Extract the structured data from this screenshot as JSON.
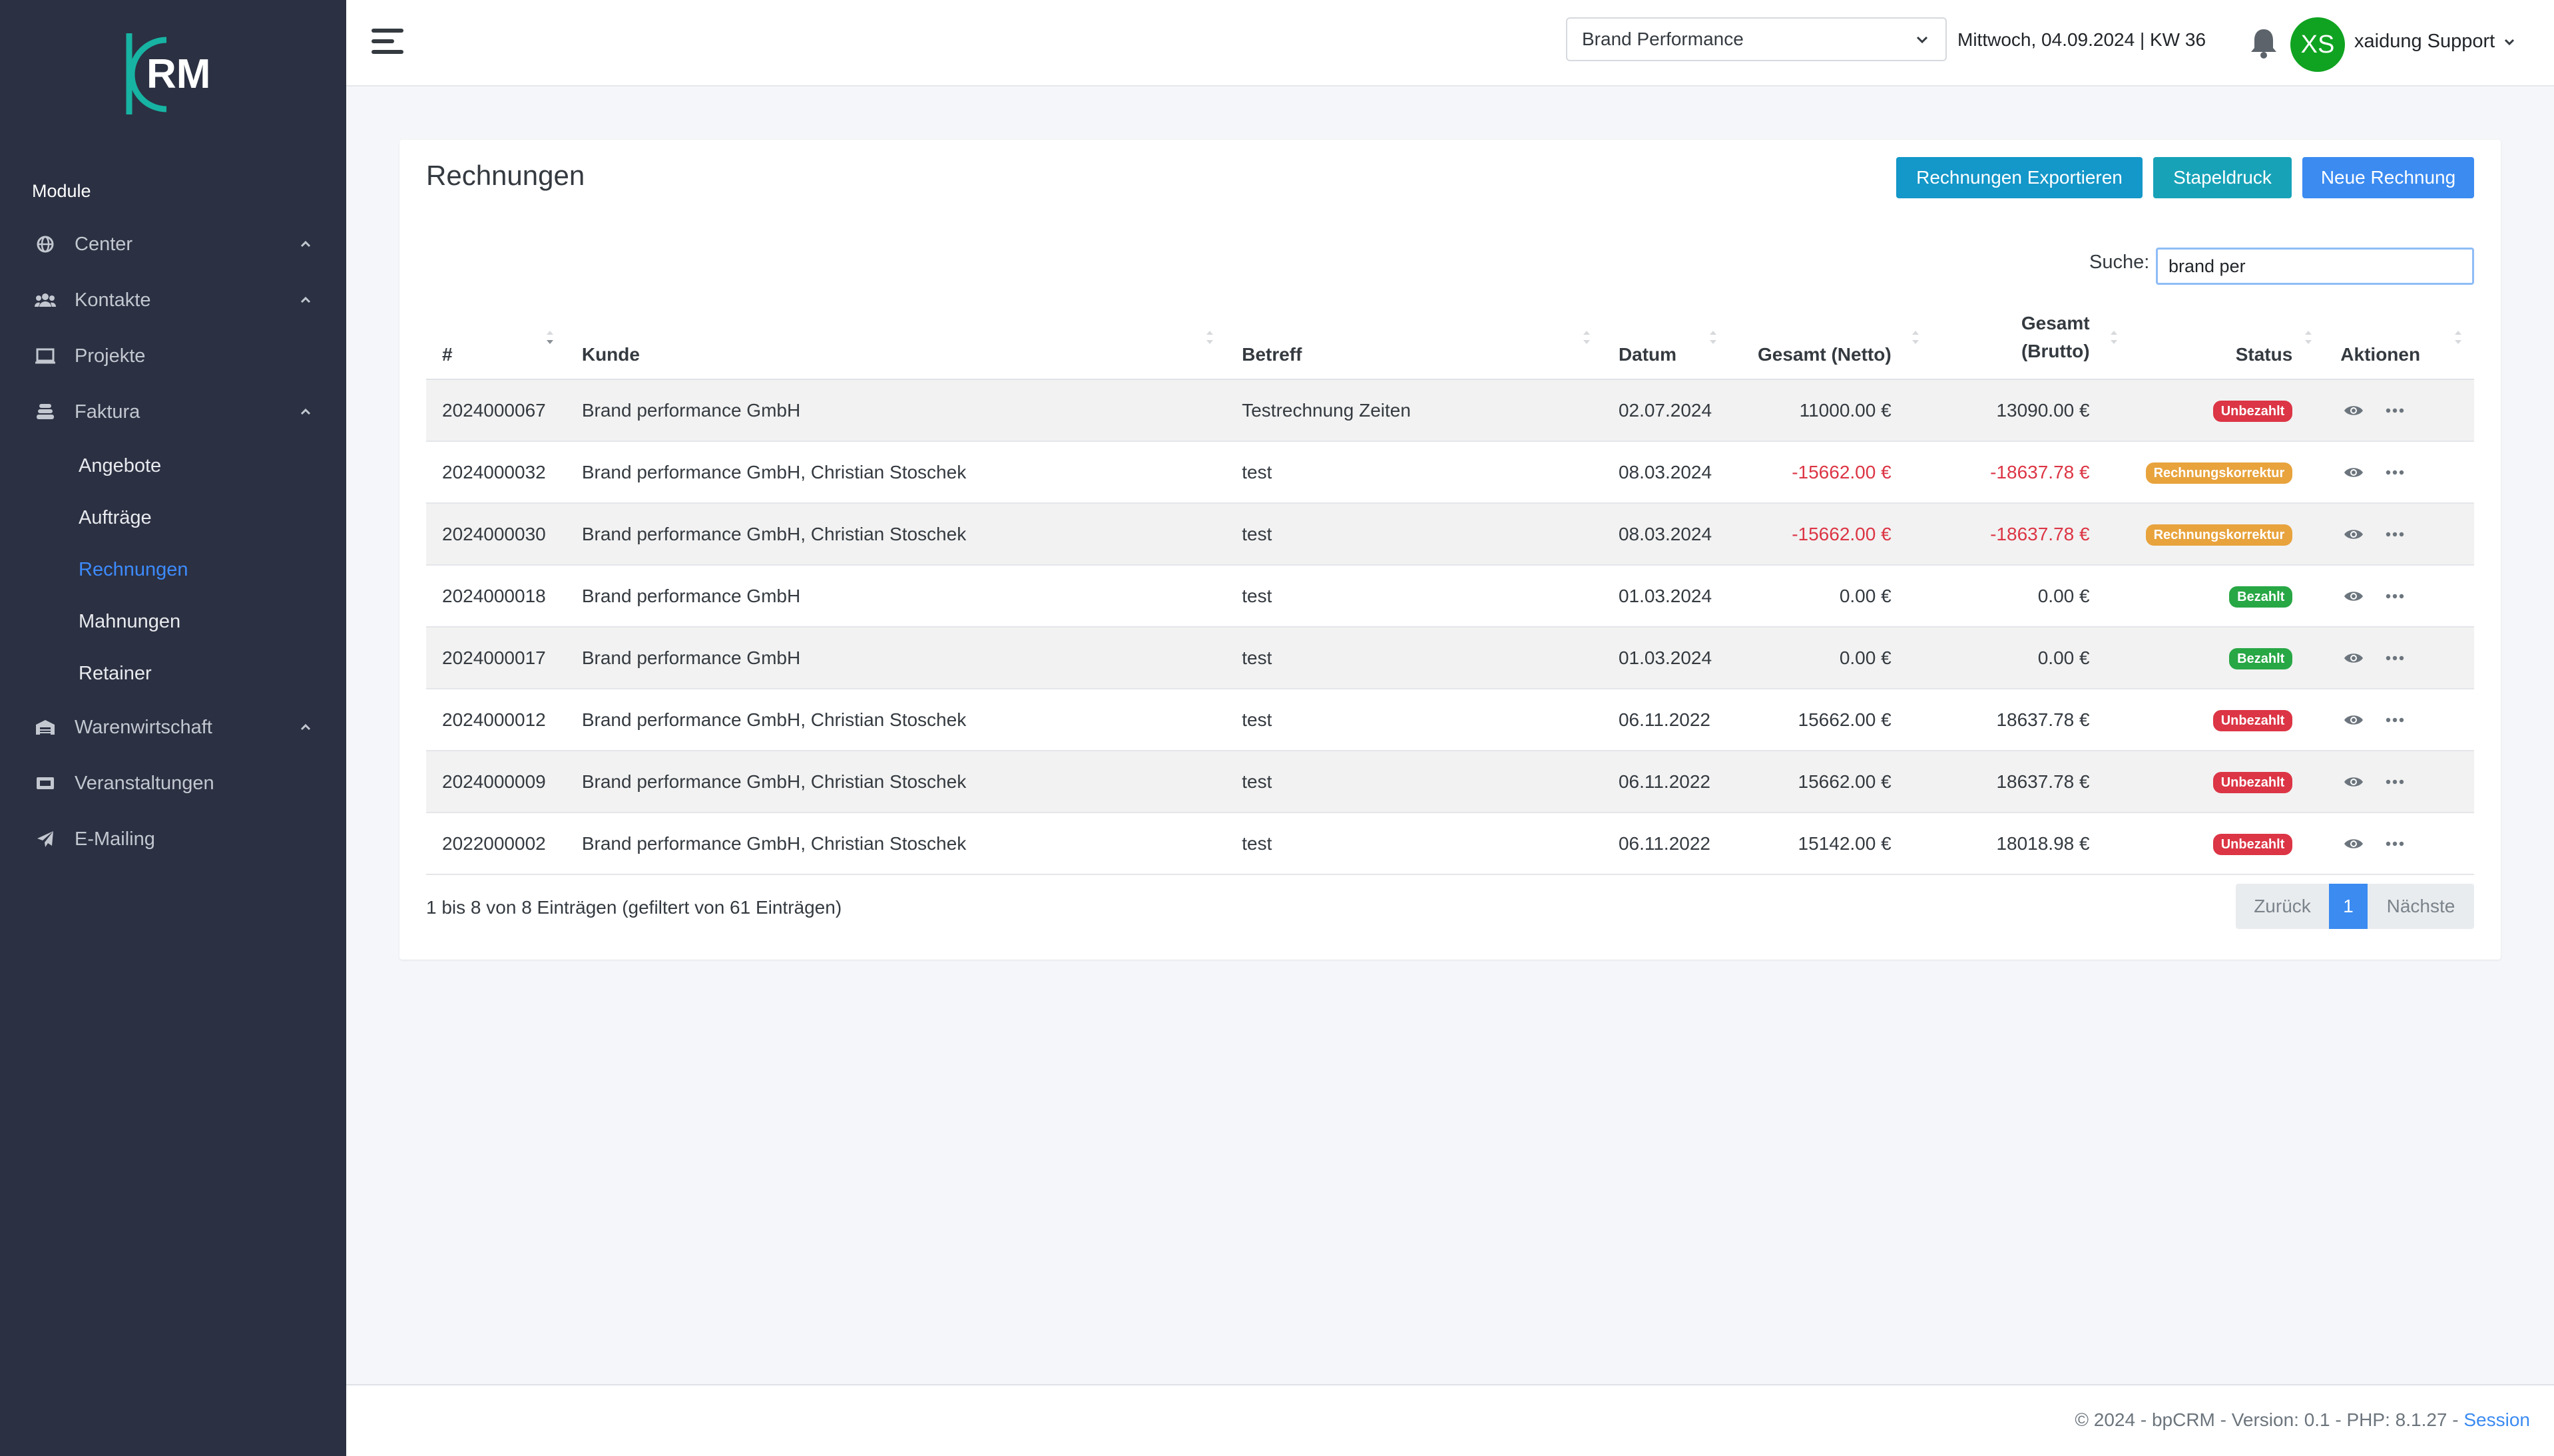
{
  "sidebar": {
    "logo_text": "RM",
    "section_label": "Module",
    "items": [
      {
        "label": "Center",
        "icon": "globe-icon",
        "expandable": true
      },
      {
        "label": "Kontakte",
        "icon": "users-icon",
        "expandable": true
      },
      {
        "label": "Projekte",
        "icon": "laptop-icon",
        "expandable": false
      },
      {
        "label": "Faktura",
        "icon": "coins-icon",
        "expandable": true
      },
      {
        "label": "Warenwirtschaft",
        "icon": "warehouse-icon",
        "expandable": true
      },
      {
        "label": "Veranstaltungen",
        "icon": "ticket-icon",
        "expandable": false
      },
      {
        "label": "E-Mailing",
        "icon": "paper-plane-icon",
        "expandable": false
      }
    ],
    "faktura_sub": [
      {
        "label": "Angebote"
      },
      {
        "label": "Aufträge"
      },
      {
        "label": "Rechnungen",
        "active": true
      },
      {
        "label": "Mahnungen"
      },
      {
        "label": "Retainer"
      }
    ]
  },
  "topbar": {
    "company_selected": "Brand Performance",
    "date_text": "Mittwoch, 04.09.2024 | KW 36",
    "avatar_initials": "XS",
    "user_name": "xaidung Support"
  },
  "page": {
    "title": "Rechnungen",
    "buttons": {
      "export": "Rechnungen Exportieren",
      "stapeldruck": "Stapeldruck",
      "neu": "Neue Rechnung"
    },
    "search": {
      "label": "Suche:",
      "value": "brand per"
    },
    "columns": [
      "#",
      "Kunde",
      "Betreff",
      "Datum",
      "Gesamt (Netto)",
      "Gesamt",
      "(Brutto)",
      "Status",
      "Aktionen"
    ],
    "rows": [
      {
        "nr": "2024000067",
        "kunde": "Brand performance GmbH",
        "betreff": "Testrechnung Zeiten",
        "datum": "02.07.2024",
        "netto": "11000.00 €",
        "brutto": "13090.00 €",
        "status": "Unbezahlt"
      },
      {
        "nr": "2024000032",
        "kunde": "Brand performance GmbH, Christian Stoschek",
        "betreff": "test",
        "datum": "08.03.2024",
        "netto": "-15662.00 €",
        "brutto": "-18637.78 €",
        "status": "Rechnungskorrektur"
      },
      {
        "nr": "2024000030",
        "kunde": "Brand performance GmbH, Christian Stoschek",
        "betreff": "test",
        "datum": "08.03.2024",
        "netto": "-15662.00 €",
        "brutto": "-18637.78 €",
        "status": "Rechnungskorrektur"
      },
      {
        "nr": "2024000018",
        "kunde": "Brand performance GmbH",
        "betreff": "test",
        "datum": "01.03.2024",
        "netto": "0.00 €",
        "brutto": "0.00 €",
        "status": "Bezahlt"
      },
      {
        "nr": "2024000017",
        "kunde": "Brand performance GmbH",
        "betreff": "test",
        "datum": "01.03.2024",
        "netto": "0.00 €",
        "brutto": "0.00 €",
        "status": "Bezahlt"
      },
      {
        "nr": "2024000012",
        "kunde": "Brand performance GmbH, Christian Stoschek",
        "betreff": "test",
        "datum": "06.11.2022",
        "netto": "15662.00 €",
        "brutto": "18637.78 €",
        "status": "Unbezahlt"
      },
      {
        "nr": "2024000009",
        "kunde": "Brand performance GmbH, Christian Stoschek",
        "betreff": "test",
        "datum": "06.11.2022",
        "netto": "15662.00 €",
        "brutto": "18637.78 €",
        "status": "Unbezahlt"
      },
      {
        "nr": "2022000002",
        "kunde": "Brand performance GmbH, Christian Stoschek",
        "betreff": "test",
        "datum": "06.11.2022",
        "netto": "15142.00 €",
        "brutto": "18018.98 €",
        "status": "Unbezahlt"
      }
    ],
    "status_colors": {
      "Unbezahlt": "#dc3545",
      "Rechnungskorrektur": "#e8a33d",
      "Bezahlt": "#28a745"
    },
    "info_text": "1 bis 8 von 8 Einträgen (gefiltert von 61 Einträgen)",
    "pagination": {
      "prev": "Zurück",
      "current": "1",
      "next": "Nächste"
    }
  },
  "footer": {
    "text": "© 2024 - bpCRM - Version: 0.1 - PHP: 8.1.27 - ",
    "session_link": "Session"
  }
}
